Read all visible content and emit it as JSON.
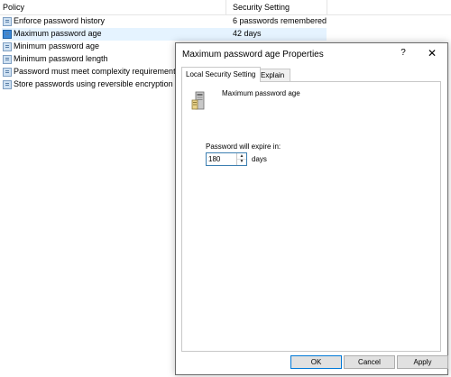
{
  "list": {
    "headers": {
      "policy": "Policy",
      "setting": "Security Setting"
    },
    "rows": [
      {
        "name": "Enforce password history",
        "value": "6 passwords remembered"
      },
      {
        "name": "Maximum password age",
        "value": "42 days"
      },
      {
        "name": "Minimum password age",
        "value": ""
      },
      {
        "name": "Minimum password length",
        "value": ""
      },
      {
        "name": "Password must meet complexity requirements",
        "value": ""
      },
      {
        "name": "Store passwords using reversible encryption",
        "value": ""
      }
    ]
  },
  "dialog": {
    "title": "Maximum password age Properties",
    "help": "?",
    "close": "✕",
    "tabs": [
      "Local Security Setting",
      "Explain"
    ],
    "policy_title": "Maximum password age",
    "expire_label": "Password will expire in:",
    "expire_value": "180",
    "unit": "days",
    "buttons": {
      "ok": "OK",
      "cancel": "Cancel",
      "apply": "Apply"
    }
  }
}
